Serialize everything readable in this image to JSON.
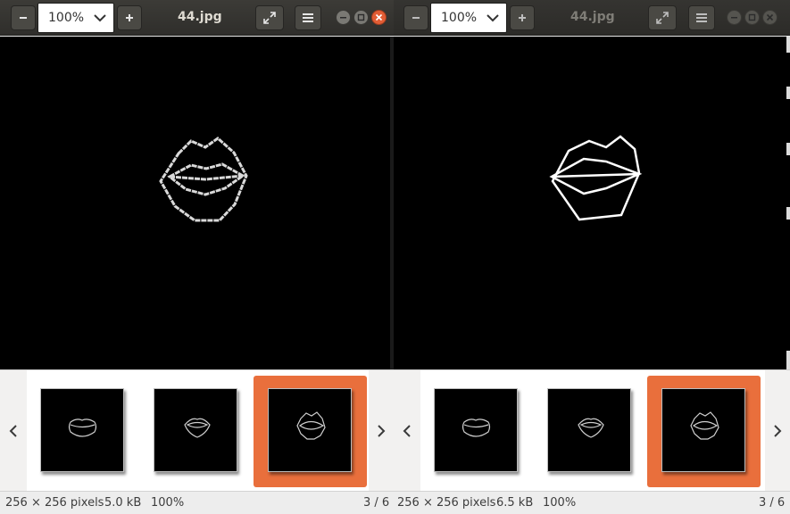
{
  "windows": [
    {
      "title": "44.jpg",
      "zoom": "100%",
      "status": {
        "dimensions": "256 × 256 pixels",
        "size": "5.0 kB",
        "zoom": "100%",
        "position": "3 / 6"
      },
      "thumbnails": [
        "lips-thumbnail-1",
        "lips-thumbnail-2",
        "lips-thumbnail-3"
      ],
      "selected_thumbnail": 3
    },
    {
      "title": "44.jpg",
      "zoom": "100%",
      "status": {
        "dimensions": "256 × 256 pixels",
        "size": "6.5 kB",
        "zoom": "100%",
        "position": "3 / 6"
      },
      "thumbnails": [
        "lips-thumbnail-1",
        "lips-thumbnail-2",
        "lips-thumbnail-3"
      ],
      "selected_thumbnail": 3
    }
  ],
  "icons": {
    "zoom_out": "minus-icon",
    "zoom_in": "plus-icon",
    "dropdown": "chevron-down-icon",
    "fullscreen": "fullscreen-icon",
    "menu": "hamburger-menu-icon",
    "minimize": "minimize-icon",
    "maximize": "maximize-icon",
    "close": "close-icon",
    "prev": "chevron-left-icon",
    "next": "chevron-right-icon"
  },
  "colors": {
    "selection": "#e96f3c",
    "close_button": "#e25d35",
    "titlebar": "#3c3b37",
    "canvas": "#000000"
  }
}
